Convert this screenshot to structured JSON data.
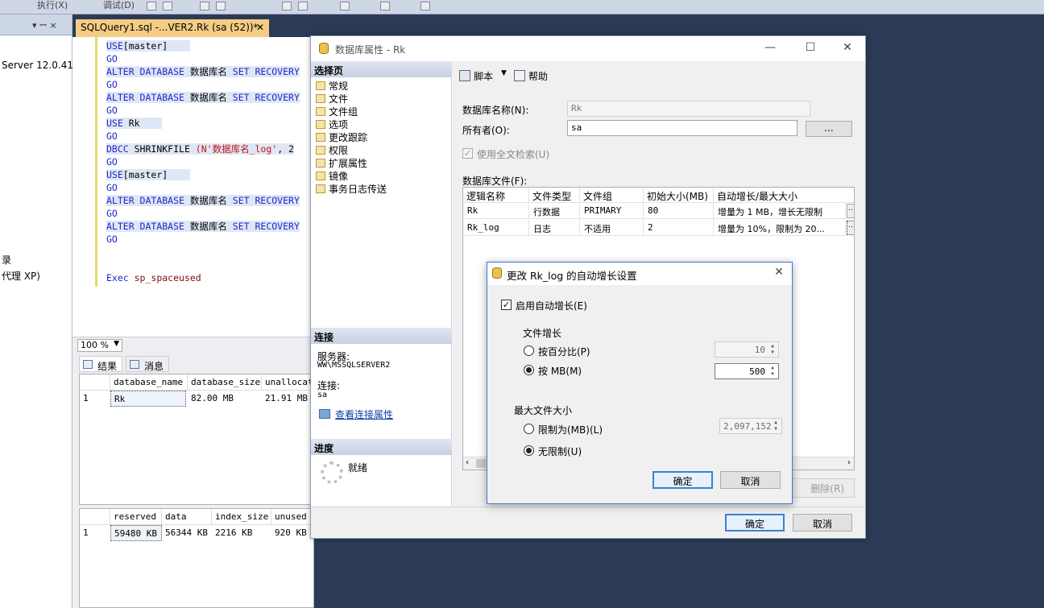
{
  "toolbar": {
    "execute": "执行(X)",
    "debug": "调试(D)"
  },
  "left_panel": {
    "header_arrows": "▾ ꟷ ×",
    "server": "Server 12.0.41",
    "item1": "录",
    "item2": "代理 XP)"
  },
  "editor": {
    "tab_title": "SQLQuery1.sql -...VER2.Rk (sa (52))*",
    "lines": {
      "l1a": "USE",
      "l1b": "[master]",
      "l2": "GO",
      "l3a": "ALTER DATABASE",
      "l3b": " 数据库名 ",
      "l3c": "SET RECOVERY",
      "l4": "GO",
      "l5a": "ALTER DATABASE",
      "l5b": " 数据库名 ",
      "l5c": "SET RECOVERY",
      "l6": "GO",
      "l7a": "USE",
      "l7b": " Rk",
      "l8": "GO",
      "l9a": "DBCC",
      "l9b": " SHRINKFILE ",
      "l9c": "(N'数据库名_log'",
      "l9d": ", 2",
      "l10": "GO",
      "l11a": "USE",
      "l11b": "[master]",
      "l12": "GO",
      "l13a": "ALTER DATABASE",
      "l13b": " 数据库名 ",
      "l13c": "SET RECOVERY",
      "l14": "GO",
      "l15a": "ALTER DATABASE",
      "l15b": " 数据库名 ",
      "l15c": "SET RECOVERY",
      "l16": "GO",
      "l17a": "Exec",
      "l17b": " sp_spaceused"
    }
  },
  "results": {
    "zoom": "100 %",
    "tab_results": "结果",
    "tab_messages": "消息",
    "grid1": {
      "headers": [
        "database_name",
        "database_size",
        "unallocated"
      ],
      "row": {
        "num": "1",
        "cells": [
          "Rk",
          "82.00 MB",
          "21.91 MB"
        ]
      }
    },
    "grid2": {
      "headers": [
        "reserved",
        "data",
        "index_size",
        "unused"
      ],
      "row": {
        "num": "1",
        "cells": [
          "59480 KB",
          "56344 KB",
          "2216 KB",
          "920 KB"
        ]
      }
    }
  },
  "props_window": {
    "title": "数据库属性 - Rk",
    "select_page_header": "选择页",
    "pages": [
      "常规",
      "文件",
      "文件组",
      "选项",
      "更改跟踪",
      "权限",
      "扩展属性",
      "镜像",
      "事务日志传送"
    ],
    "connection_header": "连接",
    "server_label": "服务器:",
    "server_value": "WW\\MSSQLSERVER2",
    "connection_label": "连接:",
    "connection_value": "sa",
    "view_conn_link": "查看连接属性",
    "progress_header": "进度",
    "progress_status": "就绪",
    "script_btn": "脚本",
    "help_btn": "帮助",
    "db_name_label": "数据库名称(N):",
    "db_name_value": "Rk",
    "owner_label": "所有者(O):",
    "owner_value": "sa",
    "browse_btn": "...",
    "fulltext_label": "使用全文检索(U)",
    "db_files_label": "数据库文件(F):",
    "file_headers": [
      "逻辑名称",
      "文件类型",
      "文件组",
      "初始大小(MB)",
      "自动增长/最大大小"
    ],
    "files": [
      [
        "Rk",
        "行数据",
        "PRIMARY",
        "80",
        "增量为 1 MB，增长无限制"
      ],
      [
        "Rk_log",
        "日志",
        "不适用",
        "2",
        "增量为 10%，限制为 20..."
      ]
    ],
    "remove_btn": "删除(R)",
    "ok_btn": "确定",
    "cancel_btn": "取消"
  },
  "autogrowth_dialog": {
    "title": "更改 Rk_log 的自动增长设置",
    "enable_label": "启用自动增长(E)",
    "file_growth_label": "文件增长",
    "percent_label": "按百分比(P)",
    "percent_value": "10",
    "mb_label": "按 MB(M)",
    "mb_value": "500",
    "max_size_label": "最大文件大小",
    "limit_label": "限制为(MB)(L)",
    "limit_value": "2,097,152",
    "unlimited_label": "无限制(U)",
    "ok_btn": "确定",
    "cancel_btn": "取消"
  }
}
